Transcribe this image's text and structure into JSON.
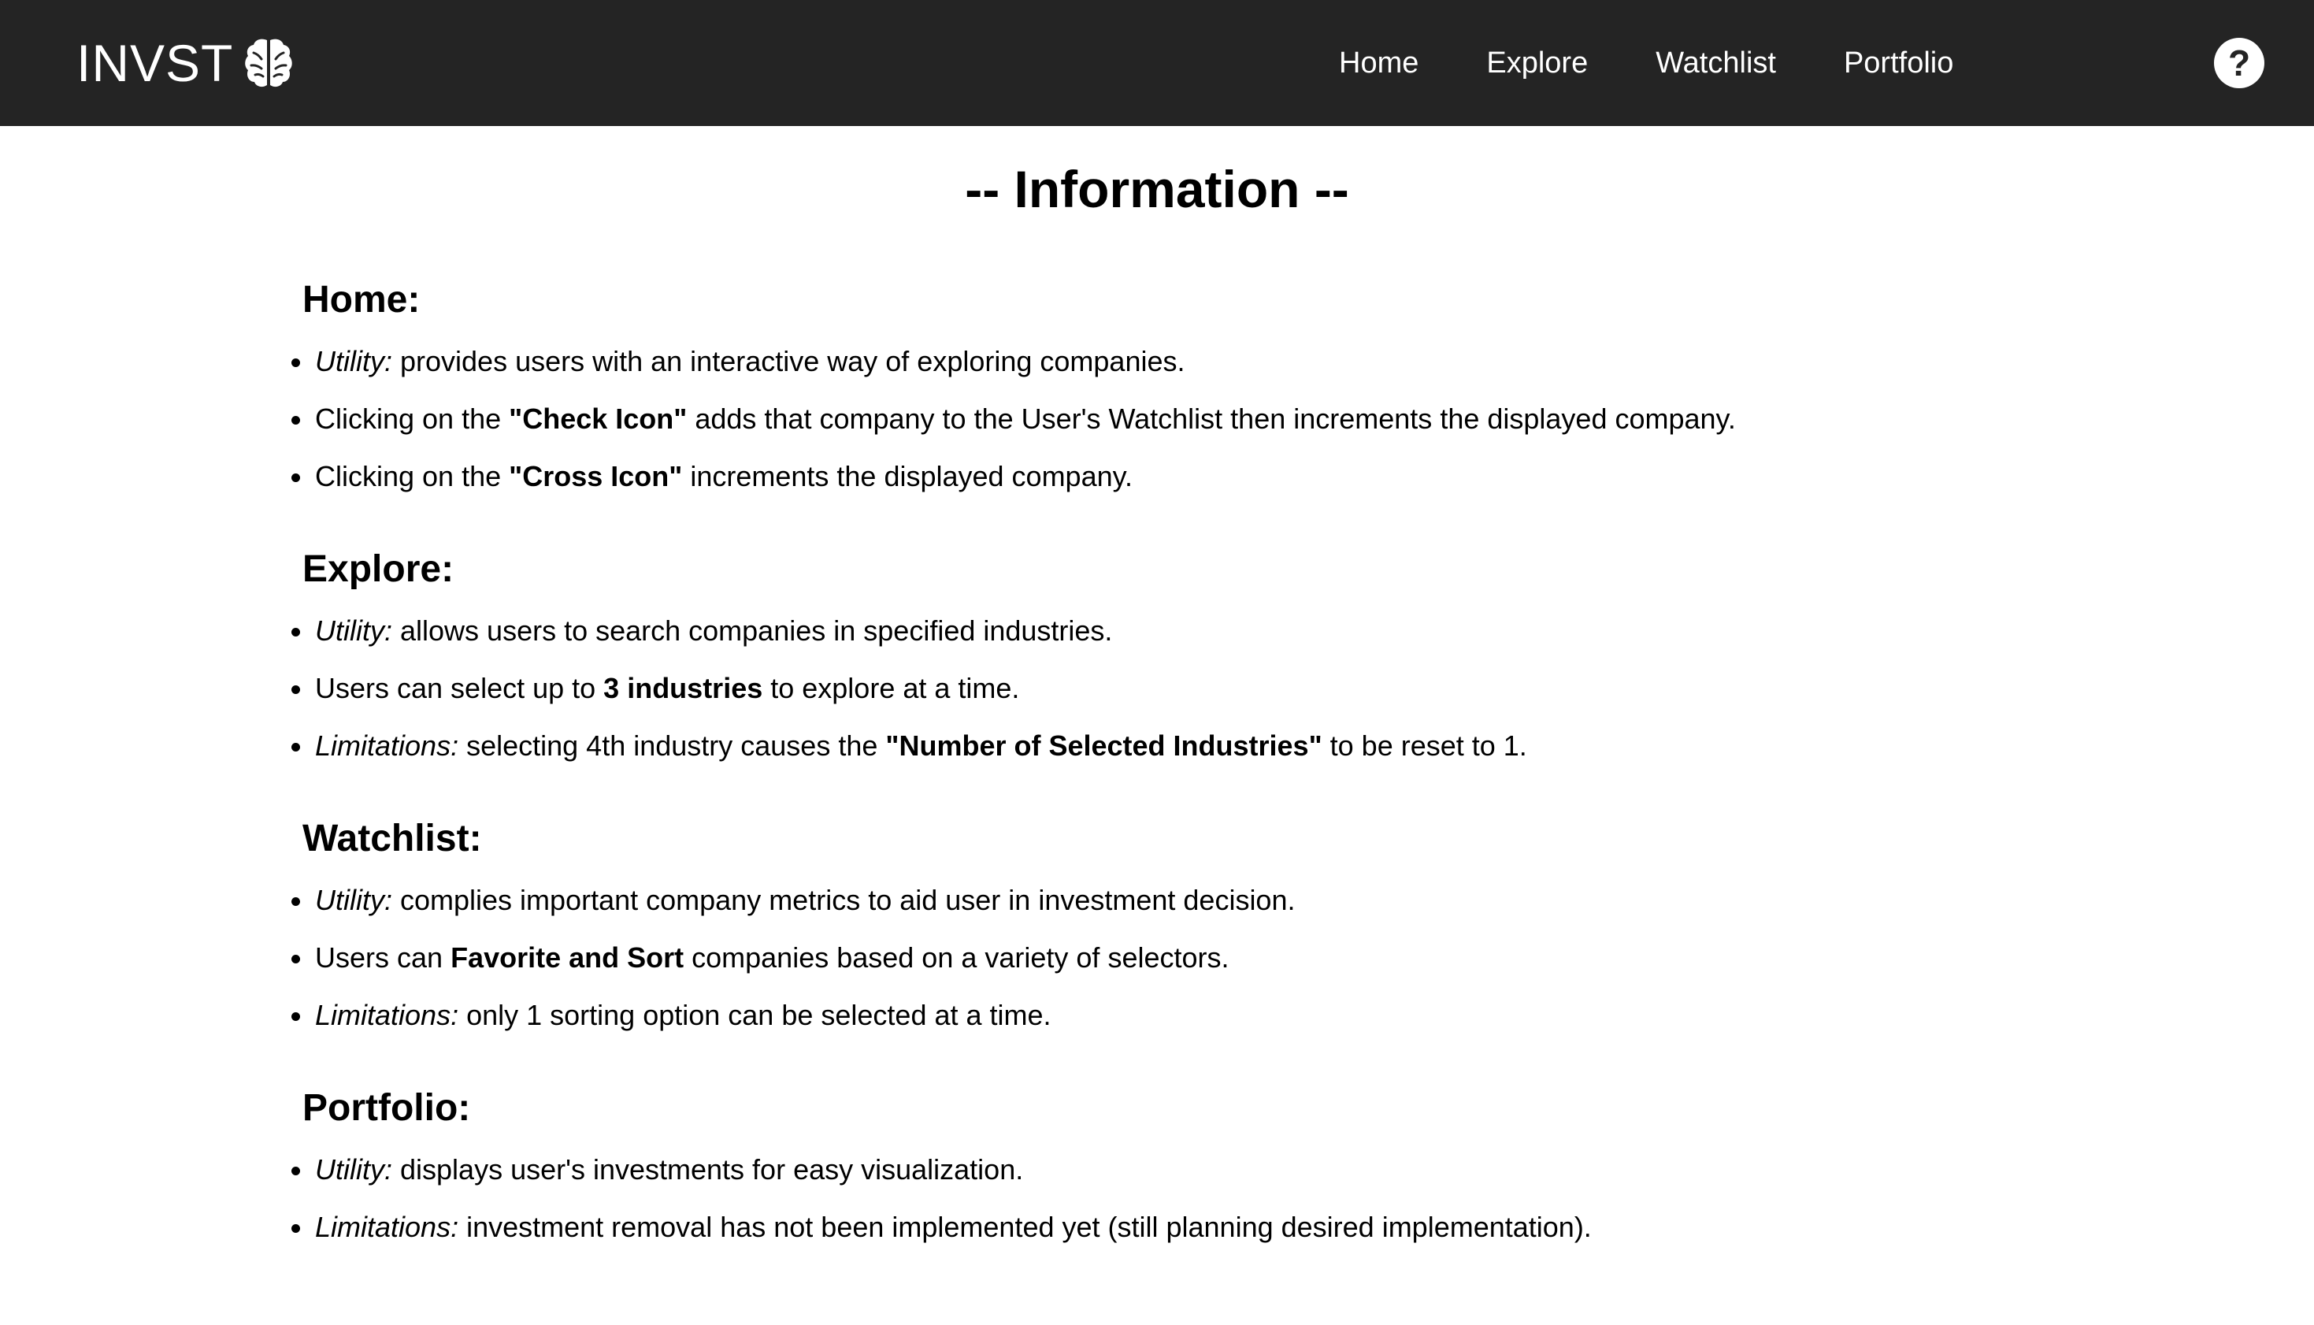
{
  "header": {
    "brand": "INVST",
    "brand_icon": "brain-icon",
    "nav": {
      "home": "Home",
      "explore": "Explore",
      "watchlist": "Watchlist",
      "portfolio": "Portfolio"
    },
    "help_label": "?"
  },
  "colors": {
    "navbar_bg": "#242424",
    "nav_text": "#ffffff",
    "page_bg": "#ffffff",
    "body_text": "#000000"
  },
  "main": {
    "title": "-- Information --",
    "sections": {
      "home": {
        "heading": "Home:",
        "items": [
          {
            "label": "Utility:",
            "text": " provides users with an interactive way of exploring companies."
          },
          {
            "pre": "Clicking on the ",
            "bold": "\"Check Icon\"",
            "post": " adds that company to the User's Watchlist then increments the displayed company."
          },
          {
            "pre": "Clicking on the ",
            "bold": "\"Cross Icon\"",
            "post": " increments the displayed company."
          }
        ]
      },
      "explore": {
        "heading": "Explore:",
        "items": [
          {
            "label": "Utility:",
            "text": " allows users to search companies in specified industries."
          },
          {
            "pre": "Users can select up to ",
            "bold": "3 industries",
            "post": " to explore at a time."
          },
          {
            "label": "Limitations:",
            "pre": " selecting 4th industry causes the ",
            "bold": "\"Number of Selected Industries\"",
            "post": " to be reset to 1."
          }
        ]
      },
      "watchlist": {
        "heading": "Watchlist:",
        "items": [
          {
            "label": "Utility:",
            "text": " complies important company metrics to aid user in investment decision."
          },
          {
            "pre": "Users can ",
            "bold": "Favorite and Sort",
            "post": " companies based on a variety of selectors."
          },
          {
            "label": "Limitations:",
            "text": " only 1 sorting option can be selected at a time."
          }
        ]
      },
      "portfolio": {
        "heading": "Portfolio:",
        "items": [
          {
            "label": "Utility:",
            "text": " displays user's investments for easy visualization."
          },
          {
            "label": "Limitations:",
            "text": " investment removal has not been implemented yet (still planning desired implementation)."
          }
        ]
      }
    }
  }
}
